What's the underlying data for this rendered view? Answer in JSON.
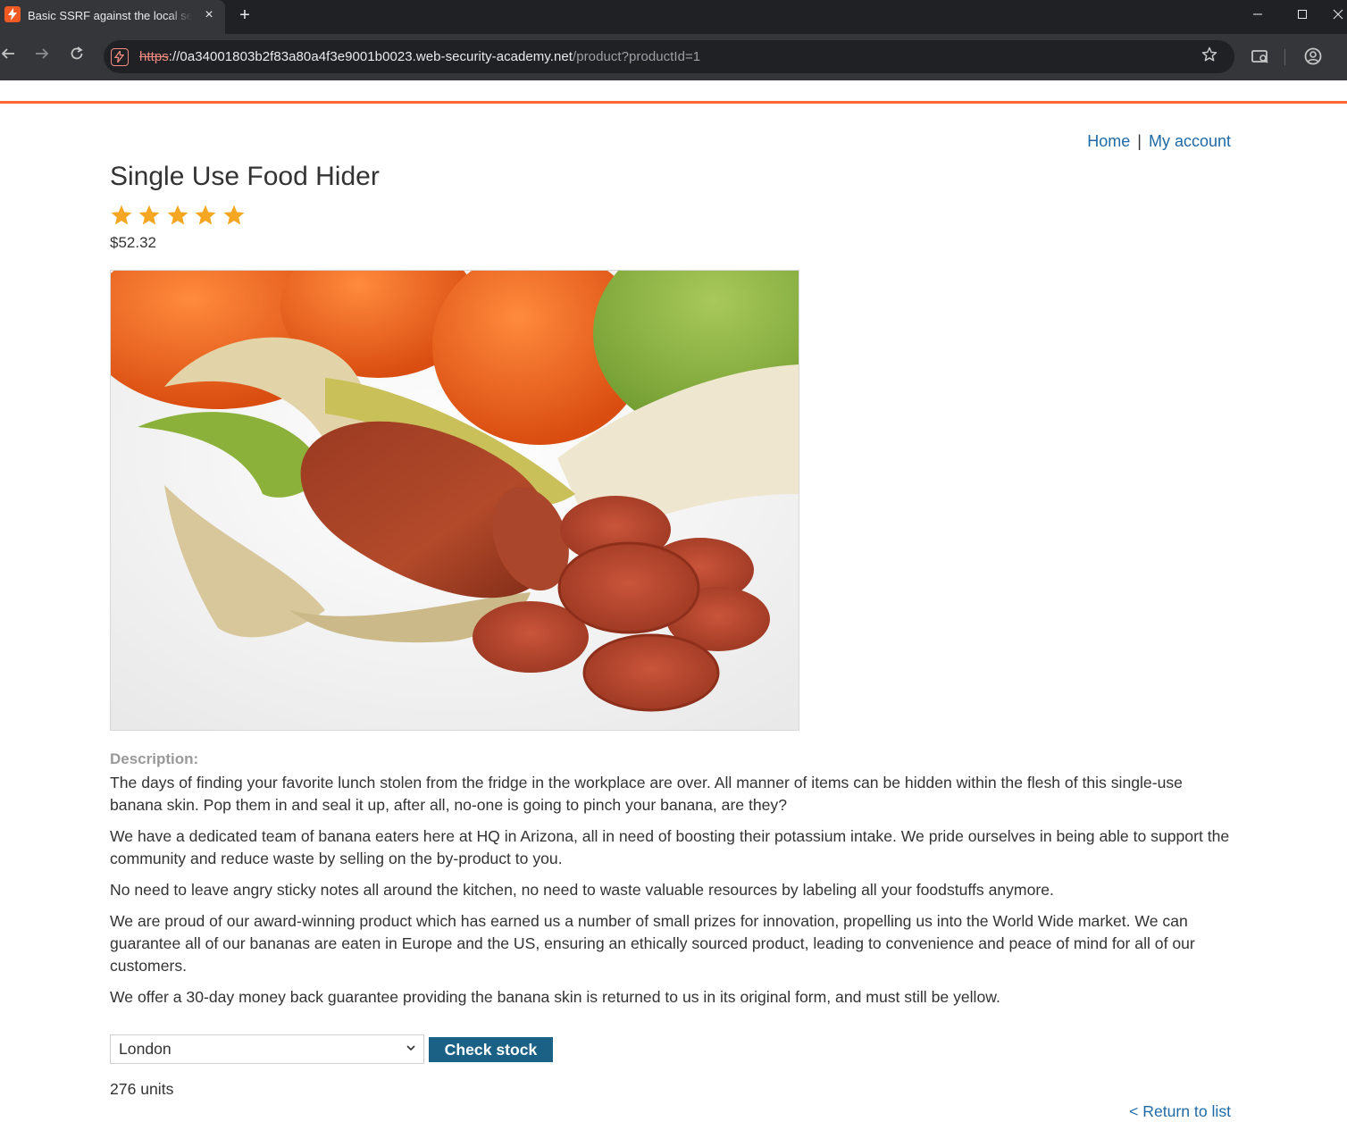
{
  "browser": {
    "tab_title": "Basic SSRF against the local server",
    "tab_close": "×",
    "new_tab": "+",
    "url_scheme": "https",
    "url_host": "://0a34001803b2f83a80a4f3e9001b0023.web-security-academy.net",
    "url_path": "/product?productId=1",
    "icons": [
      "tab-favicon",
      "back-icon",
      "forward-icon",
      "reload-icon",
      "site-icon",
      "bookmark-star-icon",
      "cast-search-icon",
      "profile-icon"
    ]
  },
  "page": {
    "accent_color": "#ff6633",
    "link_color": "#1f6aa6",
    "nav": {
      "home": "Home",
      "separator": "|",
      "account": "My account"
    },
    "product": {
      "title": "Single Use Food Hider",
      "rating": 5,
      "rating_max": 5,
      "price": "$52.32",
      "image_alt": "banana skin wrapped around a sausage with sliced chorizo and oranges"
    },
    "description_label": "Description:",
    "paragraphs": [
      "The days of finding your favorite lunch stolen from the fridge in the workplace are over. All manner of items can be hidden within the flesh of this single-use banana skin. Pop them in and seal it up, after all, no-one is going to pinch your banana, are they?",
      "We have a dedicated team of banana eaters here at HQ in Arizona, all in need of boosting their potassium intake. We pride ourselves in being able to support the community and reduce waste by selling on the by-product to you.",
      "No need to leave angry sticky notes all around the kitchen, no need to waste valuable resources by labeling all your foodstuffs anymore.",
      "We are proud of our award-winning product which has earned us a number of small prizes for innovation, propelling us into the World Wide market. We can guarantee all of our bananas are eaten in Europe and the US, ensuring an ethically sourced product, leading to convenience and peace of mind for all of our customers.",
      "We offer a 30-day money back guarantee providing the banana skin is returned to us in its original form, and must still be yellow."
    ],
    "stock": {
      "selected_store": "London",
      "button_label": "Check stock",
      "result": "276 units",
      "button_color": "#1b6186"
    },
    "return_link": "< Return to list"
  }
}
